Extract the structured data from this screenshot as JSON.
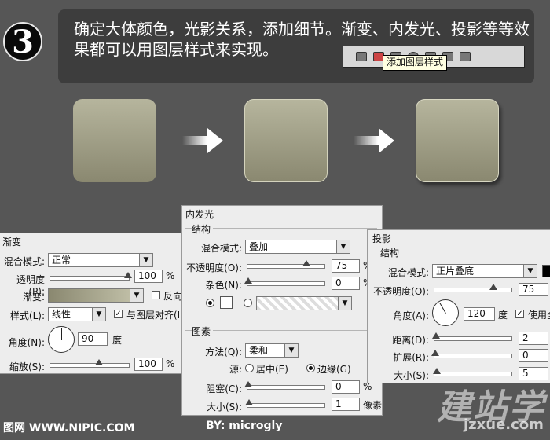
{
  "step": {
    "number": "3"
  },
  "banner": {
    "text": "确定大体颜色，光影关系，添加细节。渐变、内发光、投影等等效果都可以用图层样式来实现。",
    "tooltip": "添加图层样式"
  },
  "colors": {
    "accent_square_top": "#b6b59d",
    "accent_square_bottom": "#8a8870",
    "background": "#565656"
  },
  "gradient_panel": {
    "title": "渐变",
    "blend_mode_label": "混合模式:",
    "blend_mode_value": "正常",
    "opacity_label": "透明度(P):",
    "opacity_value": "100",
    "opacity_unit": "%",
    "gradient_label": "渐变:",
    "reverse_label": "反向(R)",
    "style_label": "样式(L):",
    "style_value": "线性",
    "align_label": "与图层对齐(I)",
    "angle_label": "角度(N):",
    "angle_value": "90",
    "angle_unit": "度",
    "scale_label": "缩放(S):",
    "scale_value": "100",
    "scale_unit": "%"
  },
  "inner_glow_panel": {
    "title": "内发光",
    "structure_label": "结构",
    "blend_mode_label": "混合模式:",
    "blend_mode_value": "叠加",
    "opacity_label": "不透明度(O):",
    "opacity_value": "75",
    "opacity_unit": "%",
    "noise_label": "杂色(N):",
    "noise_value": "0",
    "noise_unit": "%",
    "elements_label": "图素",
    "method_label": "方法(Q):",
    "method_value": "柔和",
    "source_label": "源:",
    "source_center": "居中(E)",
    "source_edge": "边缘(G)",
    "choke_label": "阻塞(C):",
    "choke_value": "0",
    "choke_unit": "%",
    "size_label": "大小(S):",
    "size_value": "1",
    "size_unit": "像素"
  },
  "drop_shadow_panel": {
    "title": "投影",
    "structure_label": "结构",
    "blend_mode_label": "混合模式:",
    "blend_mode_value": "正片叠底",
    "opacity_label": "不透明度(O):",
    "opacity_value": "75",
    "angle_label": "角度(A):",
    "angle_value": "120",
    "angle_unit": "度",
    "global_light_label": "使用全",
    "distance_label": "距离(D):",
    "distance_value": "2",
    "spread_label": "扩展(R):",
    "spread_value": "0",
    "size_label": "大小(S):",
    "size_value": "5"
  },
  "footer": {
    "left": "图网 WWW.NIPIC.COM",
    "middle": "BY: microgly",
    "watermark": "建站学",
    "watermark_sub": "jzxue.com"
  }
}
